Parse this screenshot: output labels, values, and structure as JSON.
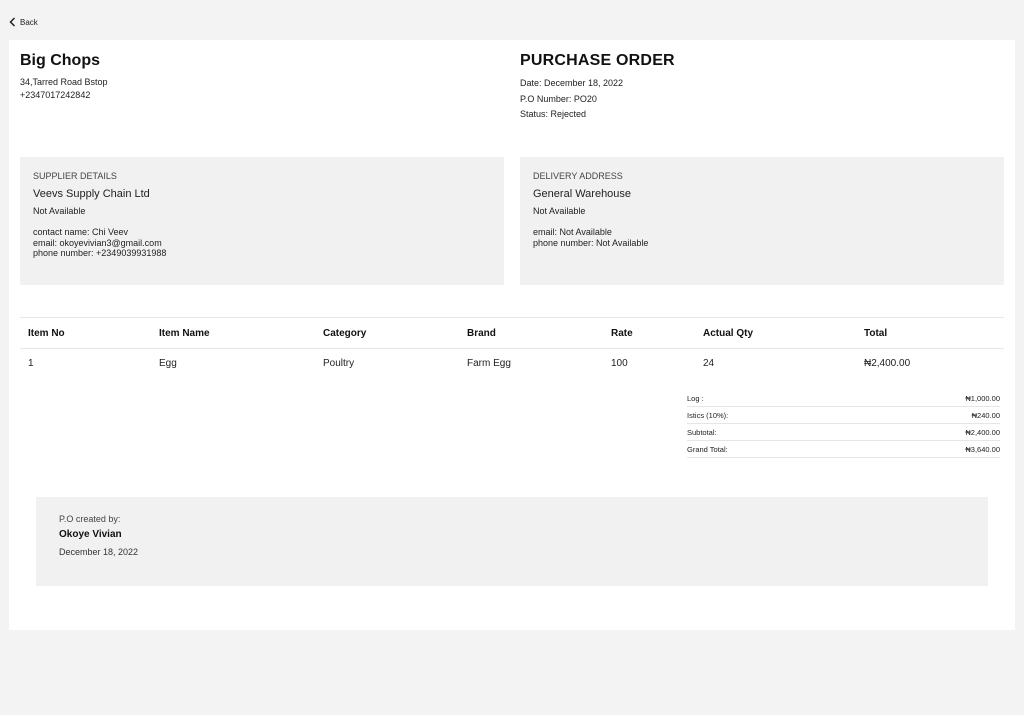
{
  "nav": {
    "back_label": "Back"
  },
  "company": {
    "name": "Big Chops",
    "address": "34,Tarred Road Bstop",
    "phone": "+2347017242842"
  },
  "po": {
    "title": "PURCHASE ORDER",
    "date": "Date: December 18, 2022",
    "number": "P.O Number: PO20",
    "status": "Status: Rejected"
  },
  "supplier": {
    "label": "SUPPLIER DETAILS",
    "name": "Veevs Supply Chain Ltd",
    "address": "Not Available",
    "contact_name": "contact name: Chi Veev",
    "email": "email: okoyevivian3@gmail.com",
    "phone": "phone number: +2349039931988"
  },
  "delivery": {
    "label": "DELIVERY ADDRESS",
    "name": "General Warehouse",
    "address": "Not Available",
    "email": "email: Not Available",
    "phone": "phone number: Not Available"
  },
  "table": {
    "headers": [
      "Item No",
      "Item Name",
      "Category",
      "Brand",
      "Rate",
      "Actual Qty",
      "Total"
    ],
    "rows": [
      [
        "1",
        "Egg",
        "Poultry",
        "Farm Egg",
        "100",
        "24",
        "₦2,400.00"
      ]
    ]
  },
  "totals": [
    {
      "label": "Log :",
      "value": "₦1,000.00"
    },
    {
      "label": "Istics (10%):",
      "value": "₦240.00"
    },
    {
      "label": "Subtotal:",
      "value": "₦2,400.00"
    },
    {
      "label": "Grand Total:",
      "value": "₦3,640.00"
    }
  ],
  "created": {
    "label": "P.O created by:",
    "name": "Okoye Vivian",
    "date": "December 18, 2022"
  }
}
